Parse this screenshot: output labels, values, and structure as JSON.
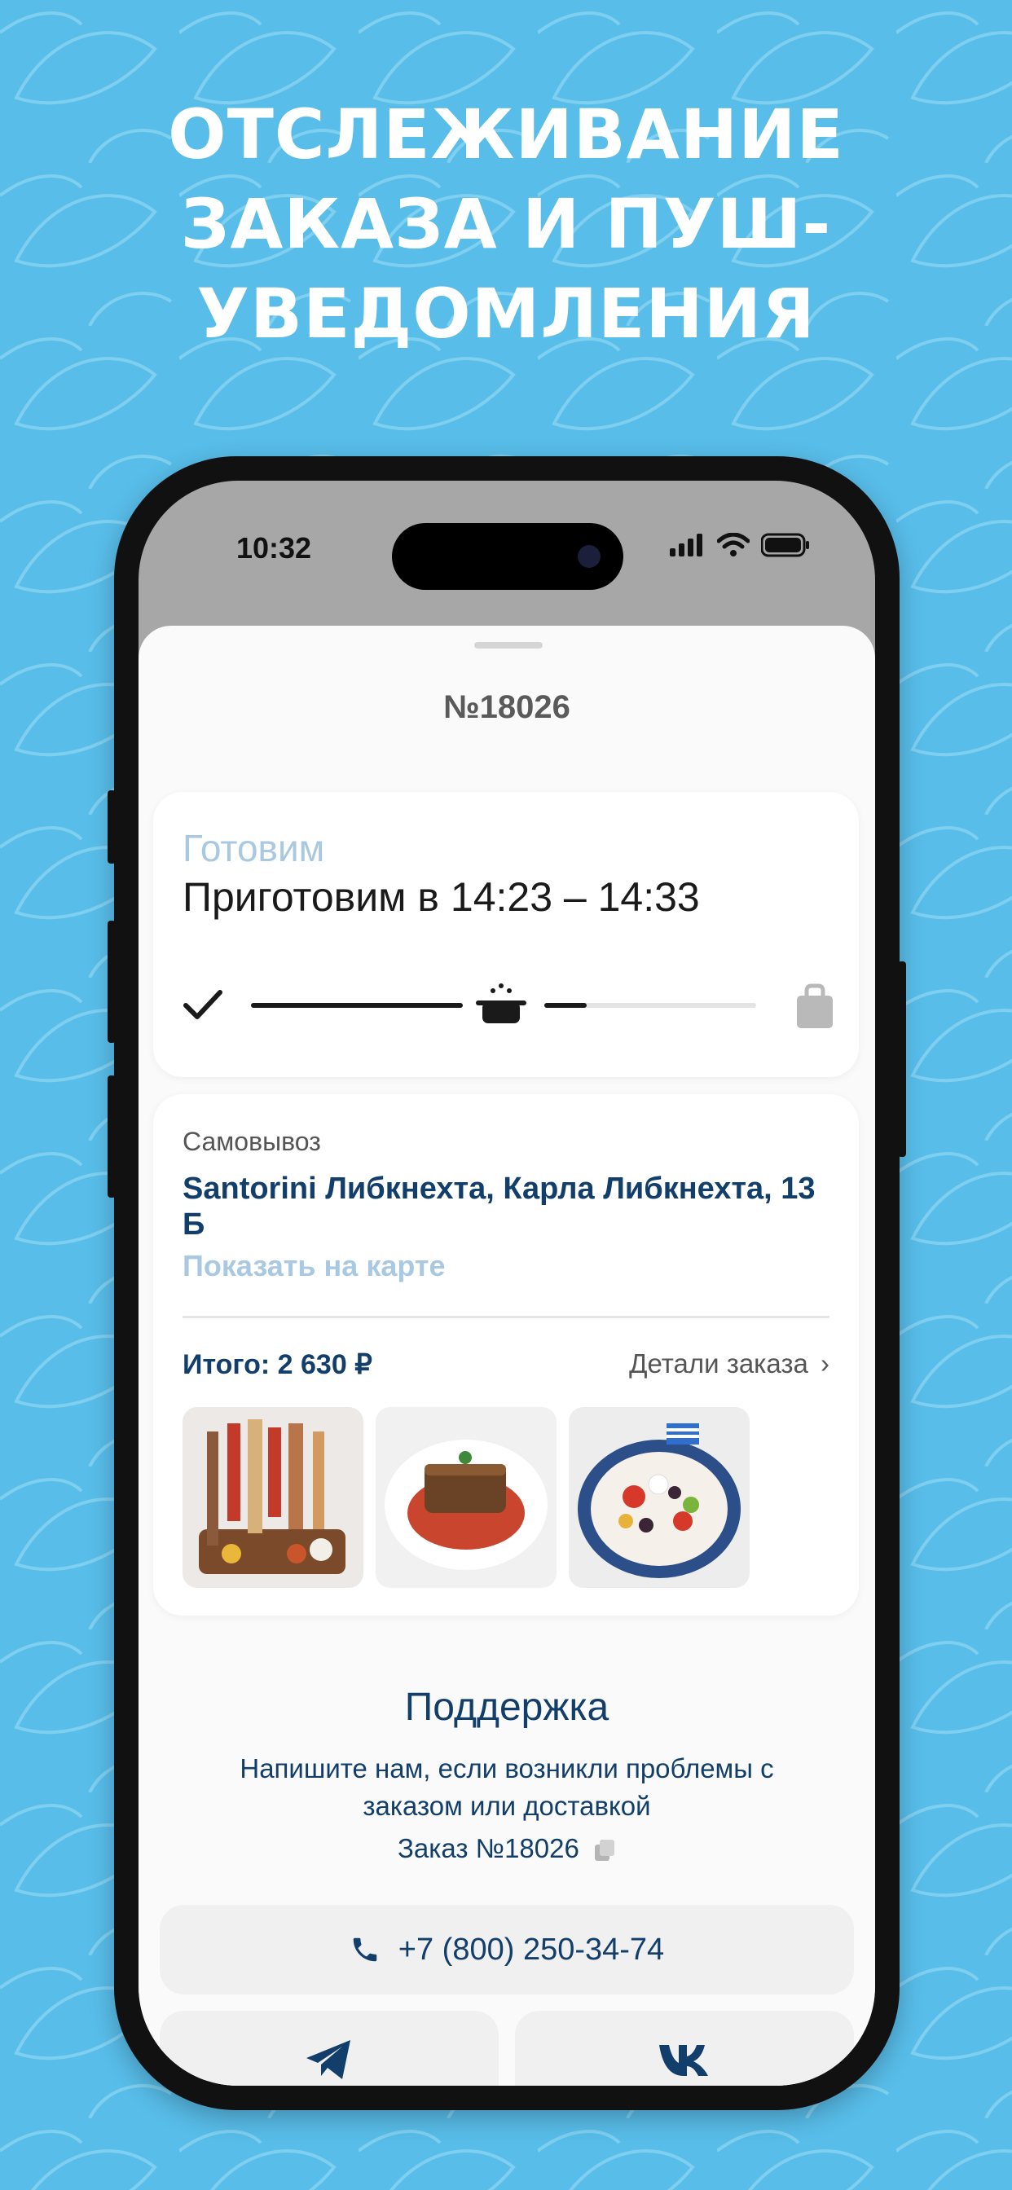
{
  "promo": {
    "headline_lines": [
      "ОТСЛЕЖИВАНИЕ",
      "ЗАКАЗА И ПУШ-",
      "УВЕДОМЛЕНИЯ"
    ]
  },
  "statusbar": {
    "time": "10:32"
  },
  "order": {
    "title": "№18026",
    "status_label": "Готовим",
    "status_time": "Приготовим в 14:23 – 14:33",
    "progress_fraction": 0.6
  },
  "pickup": {
    "kind": "Самовывоз",
    "address": "Santorini Либкнехта, Карла Либкнехта, 13 Б",
    "map_link": "Показать на карте",
    "total": "Итого: 2 630 ₽",
    "details_link": "Детали заказа",
    "thumbnails": [
      "skewers-platter",
      "moussaka",
      "greek-salad"
    ]
  },
  "support": {
    "title": "Поддержка",
    "text": "Напишите нам, если возникли проблемы с заказом или доставкой",
    "order_ref": "Заказ №18026",
    "phone": "+7 (800) 250-34-74"
  },
  "colors": {
    "background": "#58bde9",
    "accent_dark_blue": "#123e6b",
    "muted_blue": "#a9c8e1"
  },
  "icons": {
    "step_done": "check-icon",
    "step_cooking": "cooking-pot-icon",
    "step_ready": "bag-icon",
    "copy": "copy-icon",
    "phone": "phone-icon",
    "telegram": "telegram-icon",
    "vk": "vk-icon"
  }
}
